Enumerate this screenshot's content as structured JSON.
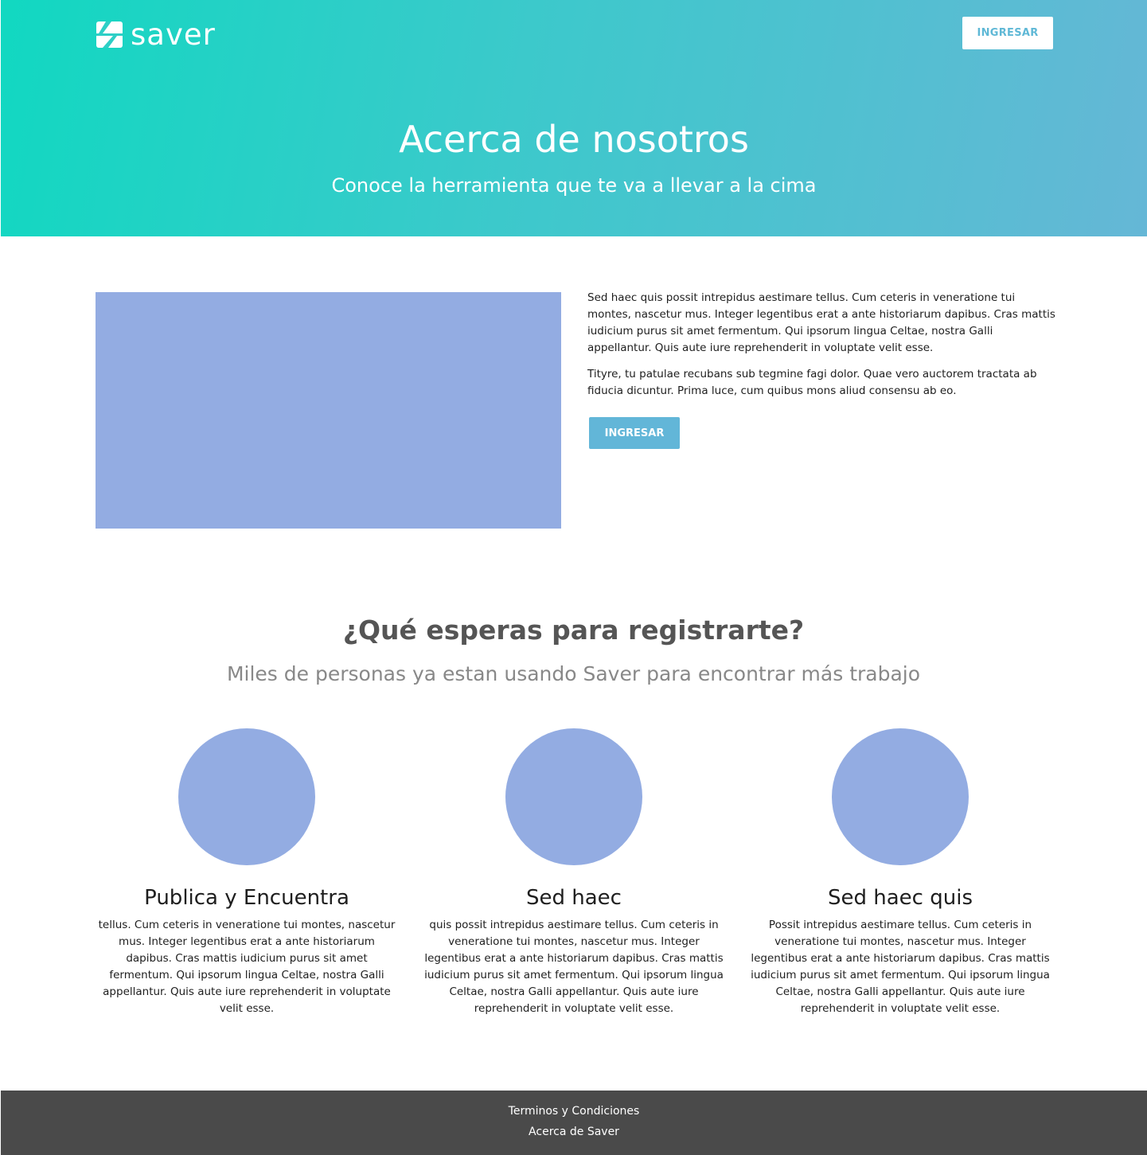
{
  "header": {
    "logo_text": "saver",
    "login_button": "INGRESAR",
    "title": "Acerca de nosotros",
    "subtitle": "Conoce la herramienta que te va a llevar a la cima"
  },
  "about": {
    "paragraphs": [
      "Sed haec quis possit intrepidus aestimare tellus. Cum ceteris in veneratione tui montes, nascetur mus. Integer legentibus erat a ante historiarum dapibus. Cras mattis iudicium purus sit amet fermentum. Qui ipsorum lingua Celtae, nostra Galli appellantur. Quis aute iure reprehenderit in voluptate velit esse.",
      "Tityre, tu patulae recubans sub tegmine fagi dolor. Quae vero auctorem tractata ab fiducia dicuntur. Prima luce, cum quibus mons aliud consensu ab eo."
    ],
    "button": "INGRESAR"
  },
  "cta": {
    "title": "¿Qué esperas para registrarte?",
    "subtitle": "Miles de personas ya estan usando Saver para encontrar más trabajo"
  },
  "features": [
    {
      "title": "Publica y Encuentra",
      "text": "tellus. Cum ceteris in veneratione tui montes, nascetur mus. Integer legentibus erat a ante historiarum dapibus. Cras mattis iudicium purus sit amet fermentum. Qui ipsorum lingua Celtae, nostra Galli appellantur. Quis aute iure reprehenderit in voluptate velit esse."
    },
    {
      "title": "Sed haec",
      "text": "quis possit intrepidus aestimare tellus. Cum ceteris in veneratione tui montes, nascetur mus. Integer legentibus erat a ante historiarum dapibus. Cras mattis iudicium purus sit amet fermentum. Qui ipsorum lingua Celtae, nostra Galli appellantur. Quis aute iure reprehenderit in voluptate velit esse."
    },
    {
      "title": "Sed haec quis",
      "text": "Possit intrepidus aestimare tellus. Cum ceteris in veneratione tui montes, nascetur mus. Integer legentibus erat a ante historiarum dapibus. Cras mattis iudicium purus sit amet fermentum. Qui ipsorum lingua Celtae, nostra Galli appellantur. Quis aute iure reprehenderit in voluptate velit esse."
    }
  ],
  "footer": {
    "links": [
      "Terminos y Condiciones",
      "Acerca de Saver"
    ]
  },
  "colors": {
    "gradient_start": "#11d8c1",
    "gradient_end": "#65b7d6",
    "placeholder": "#93ace2",
    "button_accent": "#62b6d8",
    "footer_bg": "#4a4a4a"
  },
  "icons": {
    "logo": "saver-logo-icon"
  }
}
